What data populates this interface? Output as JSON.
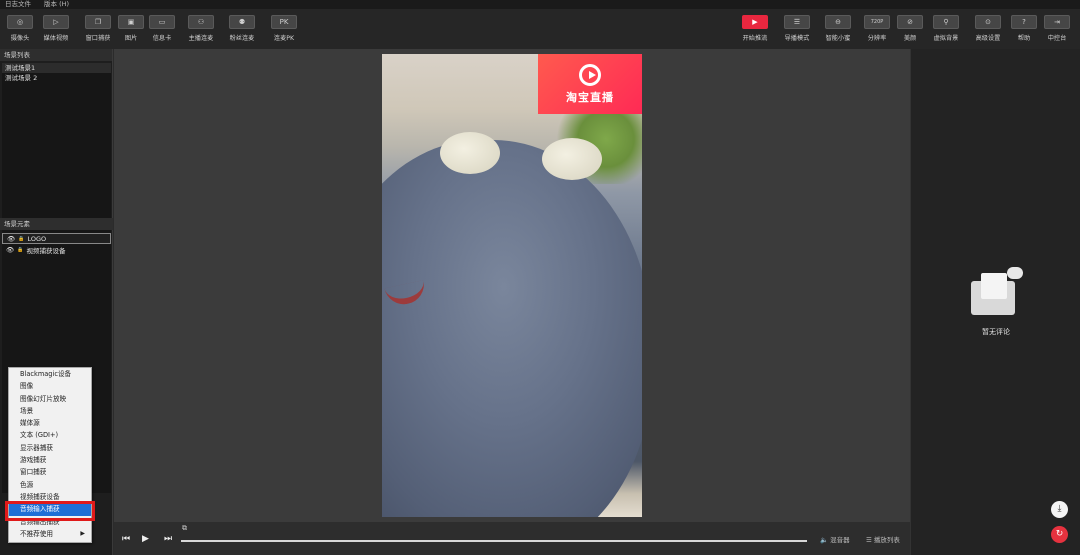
{
  "menubar": {
    "items": [
      "日志文件",
      "版本 (H)"
    ]
  },
  "toolbar": {
    "left": [
      {
        "label": "摄像头",
        "icon": "camera-icon",
        "glyph": "◎"
      },
      {
        "label": "媒体视频",
        "icon": "play-icon",
        "glyph": "▷"
      },
      {
        "label": "窗口捕获",
        "icon": "window-icon",
        "glyph": "❐"
      },
      {
        "label": "图片",
        "icon": "image-icon",
        "glyph": "▣"
      },
      {
        "label": "信息卡",
        "icon": "card-icon",
        "glyph": "▭"
      },
      {
        "label": "主播连麦",
        "icon": "user-icon",
        "glyph": "⚇"
      },
      {
        "label": "粉丝连麦",
        "icon": "fans-icon",
        "glyph": "⚉"
      },
      {
        "label": "连麦PK",
        "icon": "pk-icon",
        "glyph": "PK"
      }
    ],
    "right": [
      {
        "label": "开始推流",
        "icon": "start-stream-icon",
        "glyph": "▶",
        "accent": "#e8273f"
      },
      {
        "label": "导播模式",
        "icon": "director-icon",
        "glyph": "☰"
      },
      {
        "label": "智能小蜜",
        "icon": "assistant-icon",
        "glyph": "⊖"
      },
      {
        "label": "分辨率",
        "icon": "resolution-icon",
        "glyph": "720P"
      },
      {
        "label": "美颜",
        "icon": "beauty-icon",
        "glyph": "⊘"
      },
      {
        "label": "虚拟背景",
        "icon": "virtual-bg-icon",
        "glyph": "⚲"
      },
      {
        "label": "高级设置",
        "icon": "settings-icon",
        "glyph": "⊙"
      },
      {
        "label": "帮助",
        "icon": "help-icon",
        "glyph": "?"
      },
      {
        "label": "中控台",
        "icon": "console-icon",
        "glyph": "⇥"
      }
    ]
  },
  "scene_panel": {
    "title": "场景列表",
    "scenes": [
      "测试场景1",
      "测试场景 2"
    ],
    "controls": [
      "+",
      "—",
      "∧",
      "∨"
    ]
  },
  "element_panel": {
    "title": "场景元素",
    "elements": [
      {
        "name": "LOGO"
      },
      {
        "name": "视频捕获设备"
      }
    ]
  },
  "context_menu": {
    "items": [
      "Blackmagic设备",
      "图像",
      "图像幻灯片放映",
      "场景",
      "媒体源",
      "文本 (GDI+)",
      "显示器捕获",
      "游戏捕获",
      "窗口捕获",
      "色源",
      "视频捕获设备",
      "音频输入捕获",
      "音频输出捕获",
      "不推荐使用"
    ],
    "highlighted": "音频输入捕获"
  },
  "preview": {
    "logo_text": "淘宝直播"
  },
  "player": {
    "mixer": "混音器",
    "playlist": "播放列表"
  },
  "comments": {
    "empty_text": "暂无评论"
  }
}
